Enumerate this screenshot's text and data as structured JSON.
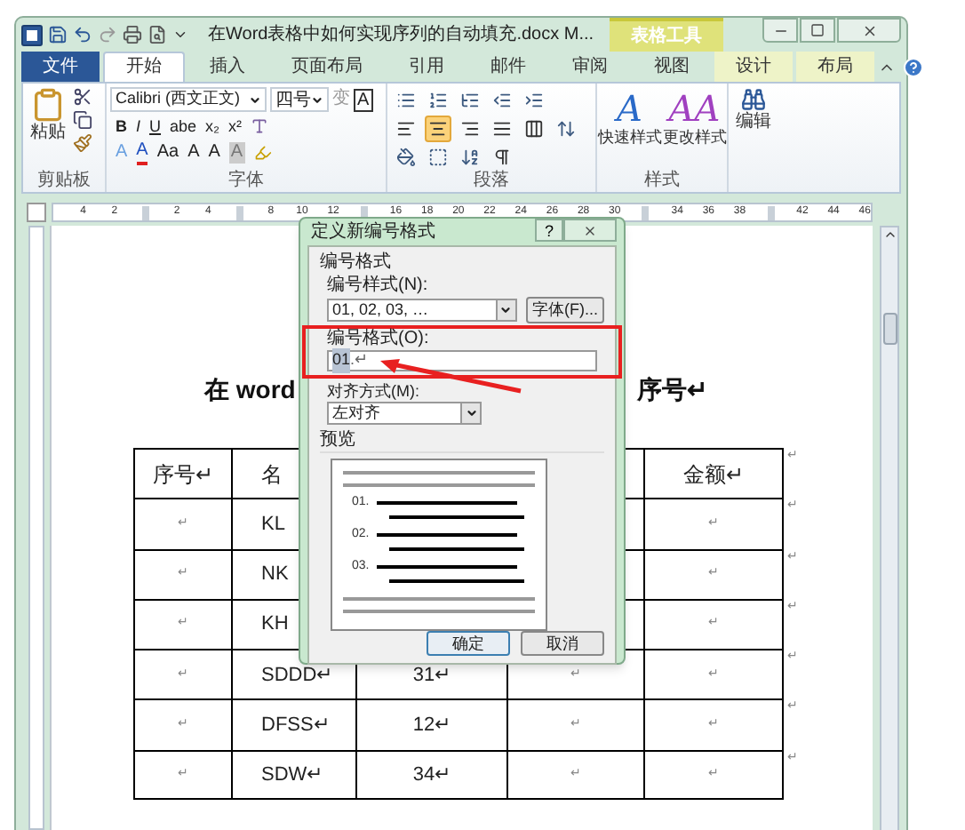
{
  "window": {
    "title": "在Word表格中如何实现序列的自动填充.docx M...",
    "context_tab_group": "表格工具"
  },
  "tabs": [
    {
      "label": "文件",
      "kind": "file",
      "selected": false
    },
    {
      "label": "开始",
      "kind": "tab",
      "selected": true
    },
    {
      "label": "插入",
      "kind": "tab",
      "selected": false
    },
    {
      "label": "页面布局",
      "kind": "tab",
      "selected": false
    },
    {
      "label": "引用",
      "kind": "tab",
      "selected": false
    },
    {
      "label": "邮件",
      "kind": "tab",
      "selected": false
    },
    {
      "label": "审阅",
      "kind": "tab",
      "selected": false
    },
    {
      "label": "视图",
      "kind": "tab",
      "selected": false
    },
    {
      "label": "设计",
      "kind": "context",
      "selected": false
    },
    {
      "label": "布局",
      "kind": "context",
      "selected": false
    }
  ],
  "ribbon": {
    "clipboard": {
      "paste": "粘贴",
      "label": "剪贴板"
    },
    "font": {
      "name": "Calibri (西文正文)",
      "size": "四号",
      "phonetic": "变",
      "border_char": "A",
      "format": [
        "B",
        "I",
        "U",
        "abe",
        "x₂",
        "x²"
      ],
      "effects": [
        "A",
        "A",
        "Aa",
        "A",
        "A",
        "A"
      ],
      "label": "字体"
    },
    "paragraph": {
      "alignments": [
        {
          "kind": "left",
          "selected": false
        },
        {
          "kind": "center",
          "selected": true
        },
        {
          "kind": "right",
          "selected": false
        },
        {
          "kind": "justify",
          "selected": false
        },
        {
          "kind": "distributed",
          "selected": false
        }
      ],
      "label": "段落"
    },
    "styles": {
      "items": [
        {
          "glyph": "A",
          "label": "快速样式"
        },
        {
          "glyph": "AA",
          "label": "更改样式"
        }
      ],
      "label": "样式"
    },
    "editing": {
      "label": "编辑"
    }
  },
  "ruler": {
    "ticks": [
      {
        "label": "4",
        "marker_after": false
      },
      {
        "label": "2",
        "marker_after": true
      },
      {
        "label": "2",
        "marker_after": false
      },
      {
        "label": "4",
        "marker_after": true
      },
      {
        "label": "8",
        "marker_after": false
      },
      {
        "label": "10",
        "marker_after": false
      },
      {
        "label": "12",
        "marker_after": true
      },
      {
        "label": "16",
        "marker_after": false
      },
      {
        "label": "18",
        "marker_after": false
      },
      {
        "label": "20",
        "marker_after": false
      },
      {
        "label": "22",
        "marker_after": false
      },
      {
        "label": "24",
        "marker_after": false
      },
      {
        "label": "26",
        "marker_after": false
      },
      {
        "label": "28",
        "marker_after": false
      },
      {
        "label": "30",
        "marker_after": true
      },
      {
        "label": "34",
        "marker_after": false
      },
      {
        "label": "36",
        "marker_after": false
      },
      {
        "label": "38",
        "marker_after": true
      },
      {
        "label": "42",
        "marker_after": false
      },
      {
        "label": "44",
        "marker_after": false
      },
      {
        "label": "46",
        "marker_after": false
      }
    ]
  },
  "document": {
    "heading_left": "在 word",
    "heading_right": "序号↵",
    "table": {
      "rows": [
        {
          "cells": [
            "序号↵",
            "名",
            null,
            null,
            "金额↵"
          ],
          "end_mark": "↵"
        },
        {
          "cells": [
            "↵",
            "KL",
            null,
            null,
            "↵"
          ],
          "end_mark": "↵"
        },
        {
          "cells": [
            "↵",
            "NK",
            null,
            null,
            "↵"
          ],
          "end_mark": "↵"
        },
        {
          "cells": [
            "↵",
            "KH",
            null,
            null,
            "↵"
          ],
          "end_mark": "↵"
        },
        {
          "cells": [
            "↵",
            "SDDD↵",
            "31↵",
            "↵",
            "↵"
          ],
          "end_mark": "↵"
        },
        {
          "cells": [
            "↵",
            "DFSS↵",
            "12↵",
            "↵",
            "↵"
          ],
          "end_mark": "↵"
        },
        {
          "cells": [
            "↵",
            "SDW↵",
            "34↵",
            "↵",
            "↵"
          ],
          "end_mark": "↵"
        }
      ]
    }
  },
  "dialog": {
    "title": "定义新编号格式",
    "help": "?",
    "group": "编号格式",
    "style_label": "编号样式(N):",
    "style_value": "01, 02, 03, …",
    "font_button": "字体(F)...",
    "format_label": "编号格式(O):",
    "format_value_selected": "01",
    "format_value_rest": ".↵",
    "align_label": "对齐方式(M):",
    "align_value": "左对齐",
    "preview_label": "预览",
    "preview_numbers": [
      "01.",
      "02.",
      "03."
    ],
    "ok": "确定",
    "cancel": "取消"
  }
}
